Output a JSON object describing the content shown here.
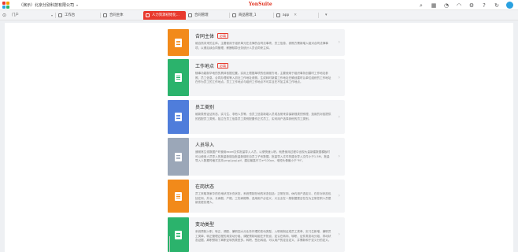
{
  "titlebar": {
    "org": "（演示）北京分别科技有限公司",
    "brand": "YonSuite",
    "logo_colors": [
      "#e8392d",
      "#f7a000",
      "#2aa1e0",
      "#2cb567"
    ]
  },
  "tabs": [
    {
      "label": "门户",
      "active": false
    },
    {
      "label": "工作台",
      "active": false
    },
    {
      "label": "合同主体",
      "active": false
    },
    {
      "label": "人力资源初始化...",
      "active": true
    },
    {
      "label": "合同管理",
      "active": false
    },
    {
      "label": "商品管理_1",
      "active": false
    },
    {
      "label": "app",
      "active": false
    }
  ],
  "cards": [
    {
      "title": "合同主体",
      "badge": "必填",
      "color": "#f28a1a",
      "desc": "维自然未来的主体。主要使用于组织单元在法律的合同法事项、员工信息、参照方需新增入组对合同法律事项，以便后续合同管理、薪酬核算业务统计人员合同来主体。"
    },
    {
      "title": "工作地点",
      "badge": "必填",
      "color": "#2bb36c",
      "desc": "随事功能制华地的的具体依据位置。实用上根据单项的信用服方地，主要使用于组织事务创建时工作地址参照、员工信息、合同办理前等入初社工作地址参照。生成转时新建工作地址在确创建时认单位组织的工作地址在作为员工的工作地点。员工工作地点与组织工作地点不可并且在不加主体工作地点。"
    },
    {
      "title": "员工类别",
      "badge": "",
      "color": "#4f7ddb",
      "desc": "维新类别证证状态，实习生、非他人员等，也员工信息新增入员或及常来讲保新规类的别理，选用的对各提供的四配员工类别。独立在员工信息员工类别配置作正式员工、实何用户选择其他的员工类别。"
    },
    {
      "title": "人员导入",
      "badge": "",
      "color": "#9ba7b8",
      "desc": "通常常生领数据户时使用excel文件批量导入人员，以便快速入职。就是使用过程中出现大量新建数据模板时可以使用人员导入的批量新增及批量新增在自员工子系数据。批量导入文件的建业导入文件小于1.5M，批量导入人数据时格式支持.png/.jpg/.gif，建议最高尺寸≥*120px，电短头像最小于“M”。"
    },
    {
      "title": "在岗状态",
      "badge": "",
      "color": "#f28a1a",
      "desc": "员工采取场家中的在地状况补充状态，系统预制在地的状态包括：正常在岗、休约用户选定义、在非对状态包括在岗、外派、长病假、产假、工伤病假等、选用用户必定义，义业业在一般制据是否在在为正常任职人员是新变更处理人。"
    },
    {
      "title": "变动类型",
      "badge": "",
      "color": "#2bb36c",
      "desc": "系统预制入职、转正、调配、兼职四大分业务作理的变动类型，入职用制证成员工类单、实习生新增、兼职员工类单、转正管理过程的用变动分组、调配预制动组在开拓设、定认在转岗、转职、证件类变动分组、异动状态证据、离职预制了离职证转的类型多。转职、签出转组，可以用户的定自定义、并需新和于定义分的定义。"
    }
  ]
}
